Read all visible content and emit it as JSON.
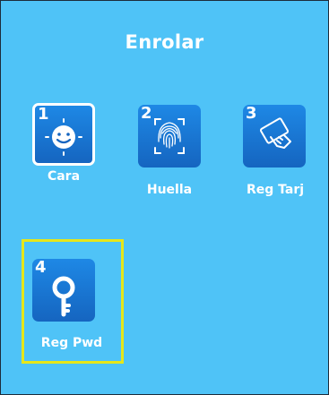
{
  "screen": {
    "title": "Enrolar"
  },
  "items": [
    {
      "number": "1",
      "label": "Cara",
      "icon": "face-icon"
    },
    {
      "number": "2",
      "label": "Huella",
      "icon": "fingerprint-icon"
    },
    {
      "number": "3",
      "label": "Reg Tarj",
      "icon": "card-icon"
    },
    {
      "number": "4",
      "label": "Reg Pwd",
      "icon": "key-icon"
    }
  ],
  "colors": {
    "background": "#4fc3f7",
    "tile": "#1e88e5",
    "focus": "#e6e61a",
    "text": "#ffffff"
  }
}
